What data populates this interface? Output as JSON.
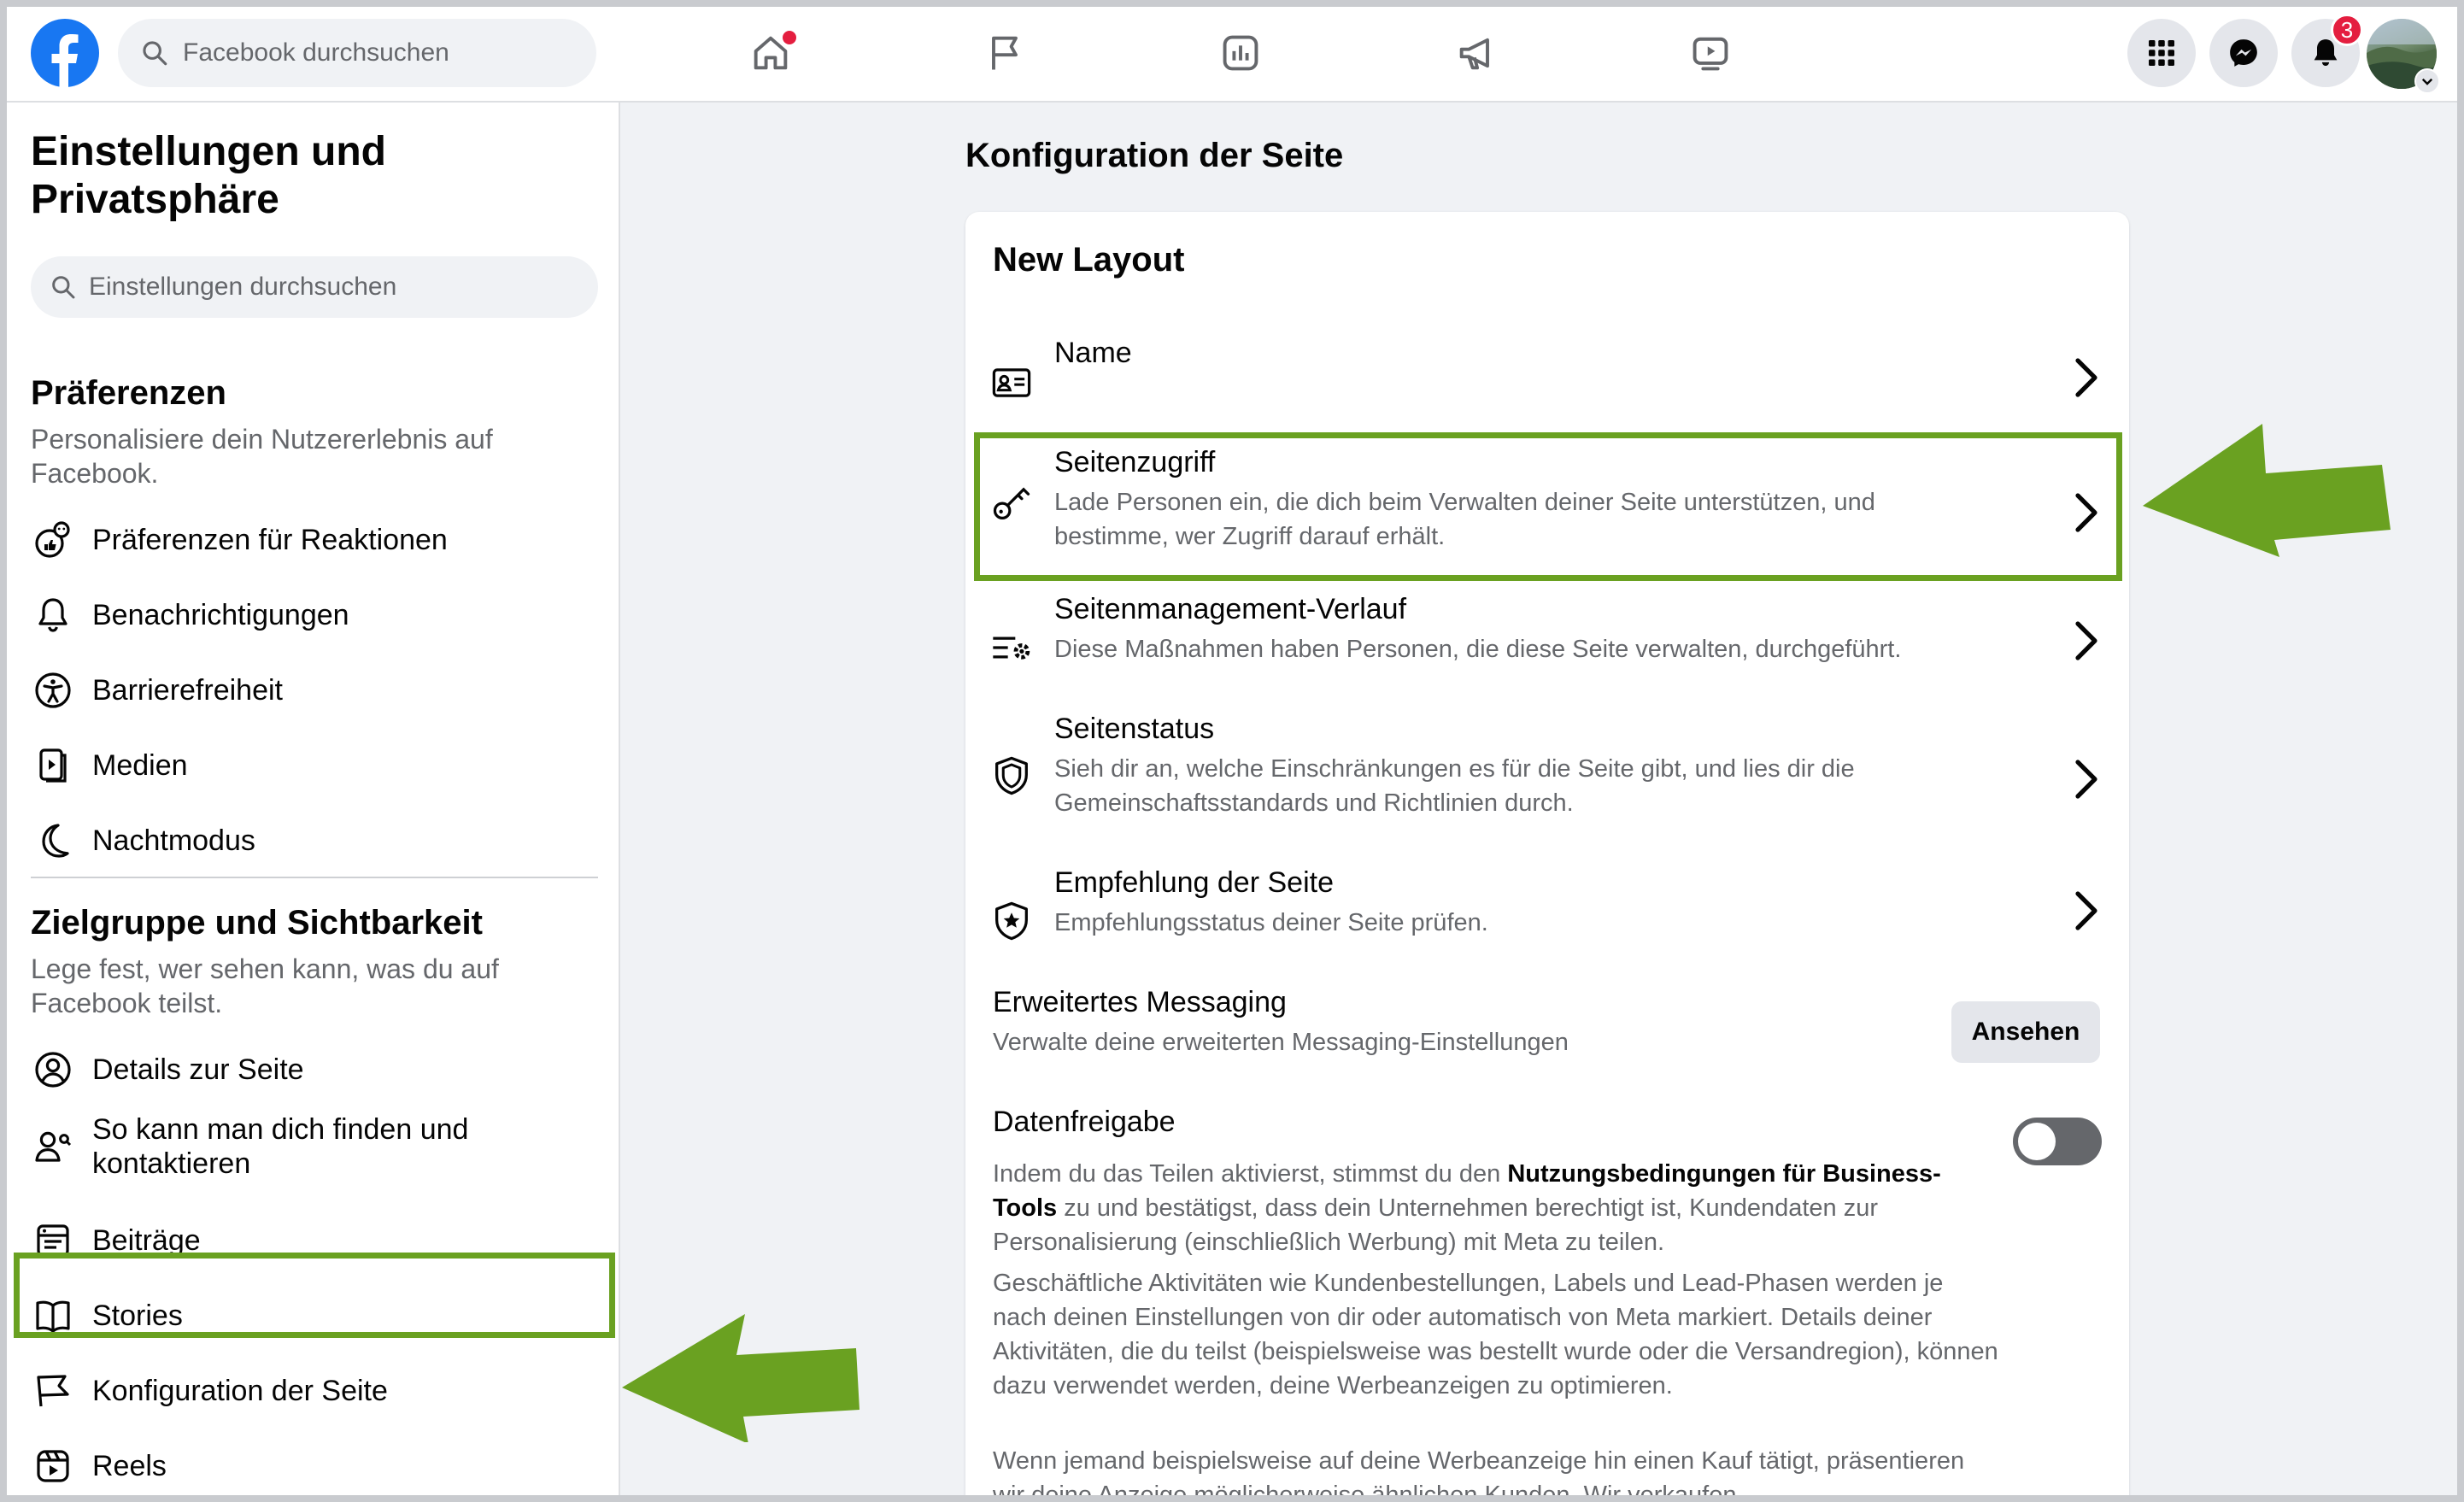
{
  "colors": {
    "accent": "#1877f2",
    "highlight_green": "#6aa121",
    "badge_red": "#e41e3f"
  },
  "topbar": {
    "search_placeholder": "Facebook durchsuchen",
    "nav_icons": [
      "home-icon",
      "flag-icon",
      "insights-icon",
      "megaphone-icon",
      "video-icon"
    ],
    "right_icons": [
      "menu-grid-icon",
      "messenger-icon",
      "bell-icon"
    ],
    "notification_count": "3"
  },
  "sidebar": {
    "title": "Einstellungen und Privatsphäre",
    "search_placeholder": "Einstellungen durchsuchen",
    "section1": {
      "heading": "Präferenzen",
      "subtitle": "Personalisiere dein Nutzererlebnis auf Facebook.",
      "items": [
        {
          "label": "Präferenzen für Reaktionen",
          "icon": "reactions-icon"
        },
        {
          "label": "Benachrichtigungen",
          "icon": "bell-icon"
        },
        {
          "label": "Barrierefreiheit",
          "icon": "accessibility-icon"
        },
        {
          "label": "Medien",
          "icon": "media-icon"
        },
        {
          "label": "Nachtmodus",
          "icon": "moon-icon"
        }
      ]
    },
    "section2": {
      "heading": "Zielgruppe und Sichtbarkeit",
      "subtitle": "Lege fest, wer sehen kann, was du auf Facebook teilst.",
      "items": [
        {
          "label": "Details zur Seite",
          "icon": "profile-icon"
        },
        {
          "label": "So kann man dich finden und kontaktieren",
          "icon": "find-contact-icon"
        },
        {
          "label": "Beiträge",
          "icon": "posts-icon"
        },
        {
          "label": "Stories",
          "icon": "stories-icon"
        },
        {
          "label": "Konfiguration der Seite",
          "icon": "flag-icon"
        },
        {
          "label": "Reels",
          "icon": "reels-icon"
        }
      ]
    }
  },
  "main": {
    "title": "Konfiguration der Seite",
    "card_heading": "New Layout",
    "rows": [
      {
        "title": "Name",
        "subtitle": "",
        "icon": "id-card-icon"
      },
      {
        "title": "Seitenzugriff",
        "subtitle": "Lade Personen ein, die dich beim Verwalten deiner Seite unterstützen, und bestimme, wer Zugriff darauf erhält.",
        "icon": "key-icon"
      },
      {
        "title": "Seitenmanagement-Verlauf",
        "subtitle": "Diese Maßnahmen haben Personen, die diese Seite verwalten, durchgeführt.",
        "icon": "list-gear-icon"
      },
      {
        "title": "Seitenstatus",
        "subtitle": "Sieh dir an, welche Einschränkungen es für die Seite gibt, und lies dir die Gemeinschaftsstandards und Richtlinien durch.",
        "icon": "shield-icon"
      },
      {
        "title": "Empfehlung der Seite",
        "subtitle": "Empfehlungsstatus deiner Seite prüfen.",
        "icon": "shield-star-icon"
      }
    ],
    "messaging": {
      "title": "Erweitertes Messaging",
      "subtitle": "Verwalte deine erweiterten Messaging-Einstellungen",
      "button": "Ansehen"
    },
    "data_sharing": {
      "title": "Datenfreigabe",
      "toggle_on": false,
      "p1_before": "Indem du das Teilen aktivierst, stimmst du den ",
      "p1_bold": "Nutzungsbedingungen für Business-Tools",
      "p1_after": " zu und bestätigst, dass dein Unternehmen berechtigt ist, Kundendaten zur Personalisierung (einschließlich Werbung) mit Meta zu teilen.",
      "p2": "Geschäftliche Aktivitäten wie Kundenbestellungen, Labels und Lead-Phasen werden je nach deinen Einstellungen von dir oder automatisch von Meta markiert. Details deiner Aktivitäten, die du teilst (beispielsweise was bestellt wurde oder die Versandregion), können dazu verwendet werden, deine Werbeanzeigen zu optimieren.",
      "p3": "Wenn jemand beispielsweise auf deine Werbeanzeige hin einen Kauf tätigt, präsentieren wir deine Anzeige möglicherweise ähnlichen Kunden. Wir verkaufen"
    }
  }
}
